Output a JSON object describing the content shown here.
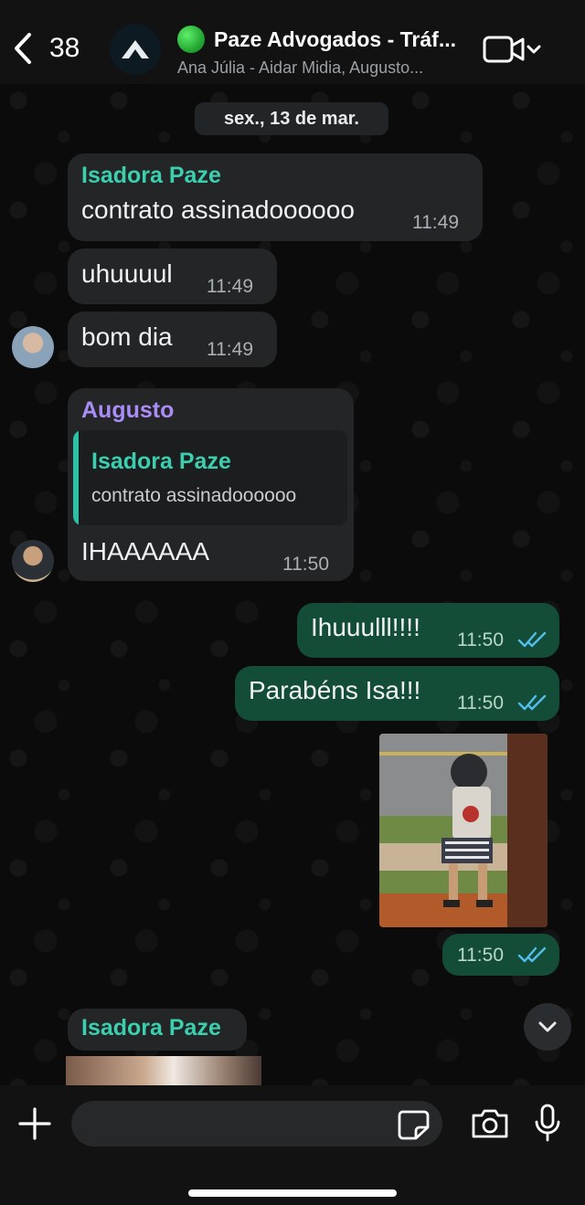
{
  "header": {
    "back_count": "38",
    "group_title": "Paze Advogados - Tráf...",
    "group_subtitle": "Ana Júlia - Aidar Midia, Augusto..."
  },
  "date_separator": "sex., 13 de mar.",
  "messages": [
    {
      "sender": "Isadora Paze",
      "text": "contrato assinadoooooo",
      "time": "11:49"
    },
    {
      "text": "uhuuuul",
      "time": "11:49"
    },
    {
      "text": "bom dia",
      "time": "11:49"
    },
    {
      "sender": "Augusto",
      "quote_sender": "Isadora Paze",
      "quote_text": "contrato assinadoooooo",
      "text": "IHAAAAAA",
      "time": "11:50"
    },
    {
      "text": "Ihuuulll!!!!",
      "time": "11:50",
      "outgoing": true
    },
    {
      "text": "Parabéns Isa!!!",
      "time": "11:50",
      "outgoing": true
    },
    {
      "type": "image",
      "time": "11:50",
      "outgoing": true
    },
    {
      "sender": "Isadora Paze",
      "type": "image"
    }
  ],
  "colors": {
    "sender_isadora": "#3ccfae",
    "sender_augusto": "#a98cf5",
    "outgoing_bubble": "#134d37",
    "incoming_bubble": "#232527",
    "read_ticks": "#53bdeb"
  },
  "icons": [
    "back-chevron-icon",
    "group-logo-icon",
    "video-call-icon",
    "chevron-down-icon",
    "plus-icon",
    "sticker-icon",
    "camera-icon",
    "microphone-icon",
    "double-check-icon"
  ]
}
